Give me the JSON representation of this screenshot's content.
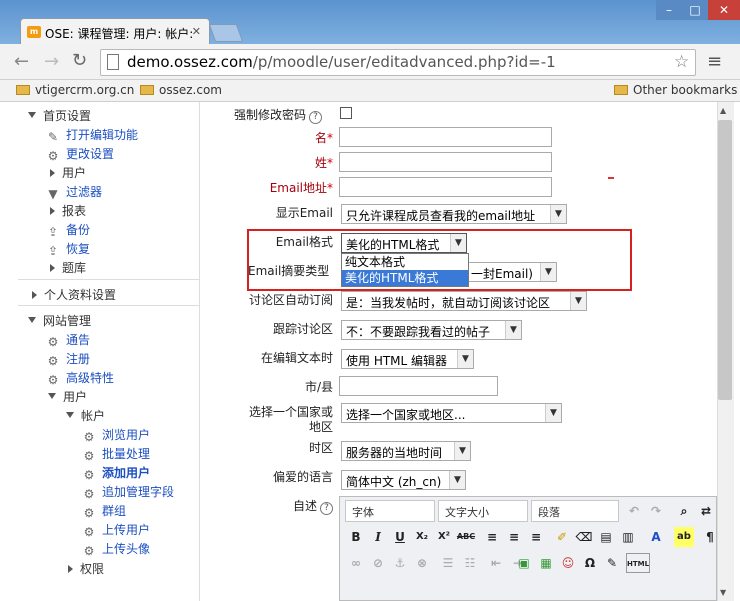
{
  "browser": {
    "tab_title": "OSE: 课程管理: 用户: 帐户:",
    "url_host": "demo.ossez.com",
    "url_path": "/p/moodle/user/editadvanced.php?id=-1",
    "bookmarks": [
      "vtigercrm.org.cn",
      "ossez.com"
    ],
    "other_bookmarks": "Other bookmarks"
  },
  "sidebar": {
    "items": [
      {
        "label": "首页设置",
        "icon": "triangle-down"
      },
      {
        "label": "打开编辑功能",
        "icon": "pencil-icon"
      },
      {
        "label": "更改设置",
        "icon": "gear-icon"
      },
      {
        "label": "用户",
        "icon": "triangle-right"
      },
      {
        "label": "过滤器",
        "icon": "filter-icon"
      },
      {
        "label": "报表",
        "icon": "triangle-right"
      },
      {
        "label": "备份",
        "icon": "upload-icon"
      },
      {
        "label": "恢复",
        "icon": "upload-icon"
      },
      {
        "label": "题库",
        "icon": "triangle-right"
      },
      {
        "label": "个人资料设置",
        "icon": "triangle-right"
      },
      {
        "label": "网站管理",
        "icon": "triangle-down"
      },
      {
        "label": "通告",
        "icon": "gear-icon"
      },
      {
        "label": "注册",
        "icon": "gear-icon"
      },
      {
        "label": "高级特性",
        "icon": "gear-icon"
      },
      {
        "label": "用户",
        "icon": "triangle-down"
      },
      {
        "label": "帐户",
        "icon": "triangle-down"
      },
      {
        "label": "浏览用户",
        "icon": "gear-icon"
      },
      {
        "label": "批量处理",
        "icon": "gear-icon"
      },
      {
        "label": "添加用户",
        "icon": "gear-icon"
      },
      {
        "label": "追加管理字段",
        "icon": "gear-icon"
      },
      {
        "label": "群组",
        "icon": "gear-icon"
      },
      {
        "label": "上传用户",
        "icon": "gear-icon"
      },
      {
        "label": "上传头像",
        "icon": "gear-icon"
      },
      {
        "label": "权限",
        "icon": "triangle-right"
      }
    ]
  },
  "form": {
    "force_pw_label": "强制修改密码",
    "firstname_label": "名",
    "lastname_label": "姓",
    "email_label": "Email地址",
    "email_display_label": "显示Email",
    "email_display_value": "只允许课程成员查看我的email地址",
    "mailformat_label": "Email格式",
    "mailformat_value": "美化的HTML格式",
    "mailformat_options": [
      "纯文本格式",
      "美化的HTML格式"
    ],
    "maildigest_label": "Email摘要类型",
    "maildigest_value": "一封Email)",
    "autosubscribe_label": "讨论区自动订阅",
    "autosubscribe_value": "是：当我发帖时，就自动订阅该讨论区",
    "tracking_label": "跟踪讨论区",
    "tracking_value": "不：不要跟踪我看过的帖子",
    "htmleditor_label": "在编辑文本时",
    "htmleditor_value": "使用 HTML 编辑器",
    "city_label": "市/县",
    "country_label_1": "选择一个国家或",
    "country_label_2": "地区",
    "country_value": "选择一个国家或地区...",
    "timezone_label": "时区",
    "timezone_value": "服务器的当地时间",
    "lang_label": "偏爱的语言",
    "lang_value": "简体中文 (zh_cn)",
    "description_label": "自述"
  },
  "editor": {
    "font": "字体",
    "size": "文字大小",
    "paragraph": "段落",
    "buttons_row2": [
      "B",
      "I",
      "U",
      "X₂",
      "X²",
      "ABC",
      "≡",
      "≡",
      "≡",
      "A",
      "ab"
    ],
    "buttons_row3": [
      "Ω",
      "HTML"
    ]
  }
}
